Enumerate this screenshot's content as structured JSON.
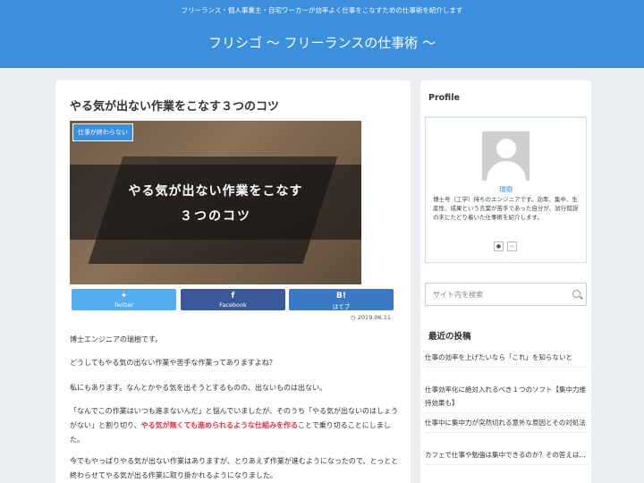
{
  "header": {
    "tagline": "フリーランス・個人事業主・自宅ワーカーが効率よく仕事をこなすための仕事術を紹介します",
    "site_title": "フリシゴ ～ フリーランスの仕事術 ～"
  },
  "article": {
    "title": "やる気が出ない作業をこなす３つのコツ",
    "category": "仕事が終わらない",
    "eyecatch_line1": "やる気が出ない作業をこなす",
    "eyecatch_line2": "３つのコツ",
    "date": "2019.06.11",
    "share": {
      "twitter": "Twitter",
      "facebook": "Facebook",
      "hatena_icon": "B!",
      "hatena": "はてブ"
    },
    "paragraphs": {
      "p1": "博士エンジニアの瑞樹です。",
      "p2": "どうしてもやる気の出ない作業や苦手な作業ってありますよね？",
      "p3": "私にもあります。なんとかやる気を出そうとするものの、出ないものは出ない。",
      "p4a": "「なんでこの作業はいつも進まないんだ」と悩んでいましたが、そのうち「やる気が出ないのはしょうがない」と割り切り、",
      "p4red": "やる気が無くても進められるような仕組みを作る",
      "p4b": "ことで乗り切ることにしました。",
      "p5": "今でもやっぱりやる気が出ない作業はありますが、とりあえず作業が進むようになったので、とっとと終わらせてやる気が出る作業に取り掛かれるようになりました。"
    }
  },
  "sidebar": {
    "profile_heading": "Profile",
    "profile_name": "瑞樹",
    "profile_desc": "博士号（工学）持ちのエンジニアです。効率、集中、生産性、成果という言葉が苦手であった自分が、試行錯誤の末にたどり着いた仕事術を紹介します。",
    "search_placeholder": "サイト内を検索",
    "recent_heading": "最近の投稿",
    "recent_posts": [
      "仕事の効率を上げたいなら「これ」を知らないと",
      "仕事効率化に絶対入れるべき１つのソフト【集中力維持効果も】",
      "仕事中に集中力が突然切れる意外な原因とその対処法",
      "カフェで仕事や勉強は集中できるのか？その答えは…"
    ]
  },
  "colors": {
    "brand": "#3b8fdc",
    "highlight": "#e0304a"
  }
}
